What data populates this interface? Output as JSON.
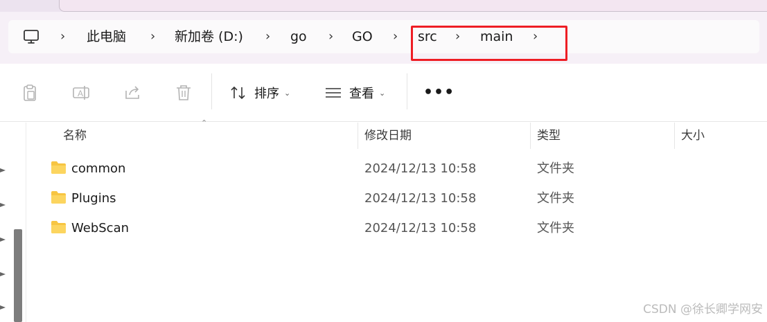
{
  "breadcrumb": {
    "items": [
      "此电脑",
      "新加卷 (D:)",
      "go",
      "GO",
      "src",
      "main"
    ],
    "highlight_color": "#ee1d24"
  },
  "toolbar": {
    "sort_label": "排序",
    "view_label": "查看",
    "more_label": "•••",
    "icons": [
      "paste-icon",
      "rename-icon",
      "share-icon",
      "delete-icon"
    ]
  },
  "columns": {
    "name": "名称",
    "modified": "修改日期",
    "type": "类型",
    "size": "大小"
  },
  "files": [
    {
      "name": "common",
      "modified": "2024/12/13 10:58",
      "type": "文件夹"
    },
    {
      "name": "Plugins",
      "modified": "2024/12/13 10:58",
      "type": "文件夹"
    },
    {
      "name": "WebScan",
      "modified": "2024/12/13 10:58",
      "type": "文件夹"
    }
  ],
  "watermark": "CSDN @徐长卿学网安"
}
